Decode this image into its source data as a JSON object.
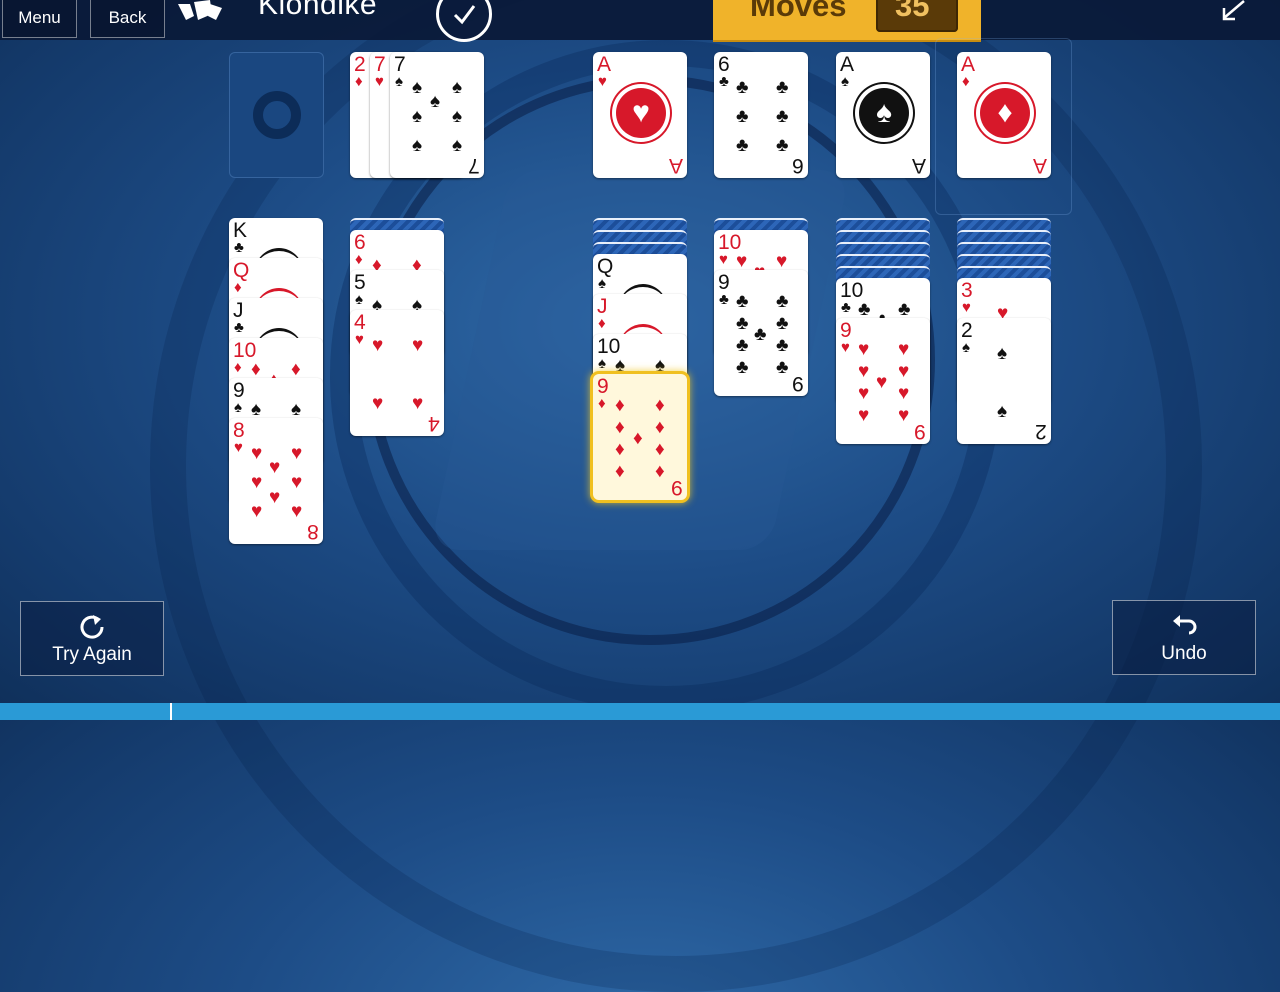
{
  "header": {
    "menu_label": "Menu",
    "back_label": "Back",
    "title": "Klondike",
    "moves_label": "Moves",
    "moves_value": "35"
  },
  "colors": {
    "red_suit": "#d7182a",
    "black_suit": "#111111",
    "moves_panel": "#f0b32a",
    "selection": "#f0c020"
  },
  "waste": [
    {
      "rank": "2",
      "suit": "♦",
      "color": "red"
    },
    {
      "rank": "7",
      "suit": "♥",
      "color": "red"
    },
    {
      "rank": "7",
      "suit": "♠",
      "color": "black"
    }
  ],
  "foundations": [
    {
      "rank": "A",
      "suit": "♥",
      "color": "red"
    },
    {
      "rank": "6",
      "suit": "♣",
      "color": "black"
    },
    {
      "rank": "A",
      "suit": "♠",
      "color": "black"
    },
    {
      "rank": "A",
      "suit": "♦",
      "color": "red"
    }
  ],
  "tableau": [
    {
      "facedown": 0,
      "cards": [
        {
          "rank": "K",
          "suit": "♣",
          "color": "black"
        },
        {
          "rank": "Q",
          "suit": "♦",
          "color": "red"
        },
        {
          "rank": "J",
          "suit": "♣",
          "color": "black"
        },
        {
          "rank": "10",
          "suit": "♦",
          "color": "red"
        },
        {
          "rank": "9",
          "suit": "♠",
          "color": "black"
        },
        {
          "rank": "8",
          "suit": "♥",
          "color": "red"
        }
      ]
    },
    {
      "facedown": 1,
      "cards": [
        {
          "rank": "6",
          "suit": "♦",
          "color": "red"
        },
        {
          "rank": "5",
          "suit": "♠",
          "color": "black"
        },
        {
          "rank": "4",
          "suit": "♥",
          "color": "red"
        }
      ]
    },
    {
      "facedown": 0,
      "cards": []
    },
    {
      "facedown": 3,
      "cards": [
        {
          "rank": "Q",
          "suit": "♠",
          "color": "black"
        },
        {
          "rank": "J",
          "suit": "♦",
          "color": "red"
        },
        {
          "rank": "10",
          "suit": "♠",
          "color": "black"
        },
        {
          "rank": "9",
          "suit": "♦",
          "color": "red",
          "selected": true
        }
      ]
    },
    {
      "facedown": 1,
      "cards": [
        {
          "rank": "10",
          "suit": "♥",
          "color": "red"
        },
        {
          "rank": "9",
          "suit": "♣",
          "color": "black"
        }
      ]
    },
    {
      "facedown": 5,
      "cards": [
        {
          "rank": "10",
          "suit": "♣",
          "color": "black"
        },
        {
          "rank": "9",
          "suit": "♥",
          "color": "red"
        }
      ]
    },
    {
      "facedown": 5,
      "cards": [
        {
          "rank": "3",
          "suit": "♥",
          "color": "red"
        },
        {
          "rank": "2",
          "suit": "♠",
          "color": "black"
        }
      ]
    }
  ],
  "footer": {
    "try_again_label": "Try Again",
    "undo_label": "Undo"
  }
}
